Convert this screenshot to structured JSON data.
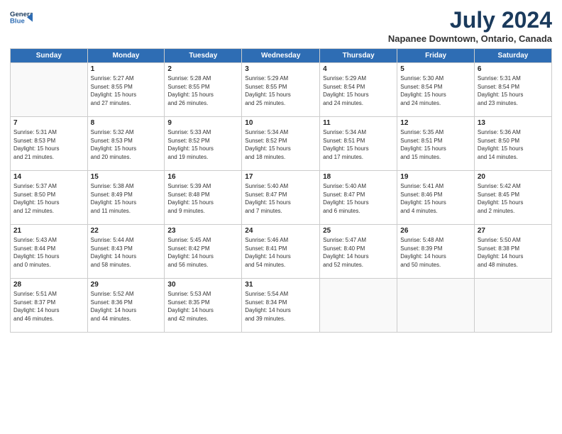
{
  "logo": {
    "line1": "General",
    "line2": "Blue"
  },
  "title": "July 2024",
  "subtitle": "Napanee Downtown, Ontario, Canada",
  "days_header": [
    "Sunday",
    "Monday",
    "Tuesday",
    "Wednesday",
    "Thursday",
    "Friday",
    "Saturday"
  ],
  "weeks": [
    [
      {
        "day": "",
        "info": ""
      },
      {
        "day": "1",
        "info": "Sunrise: 5:27 AM\nSunset: 8:55 PM\nDaylight: 15 hours\nand 27 minutes."
      },
      {
        "day": "2",
        "info": "Sunrise: 5:28 AM\nSunset: 8:55 PM\nDaylight: 15 hours\nand 26 minutes."
      },
      {
        "day": "3",
        "info": "Sunrise: 5:29 AM\nSunset: 8:55 PM\nDaylight: 15 hours\nand 25 minutes."
      },
      {
        "day": "4",
        "info": "Sunrise: 5:29 AM\nSunset: 8:54 PM\nDaylight: 15 hours\nand 24 minutes."
      },
      {
        "day": "5",
        "info": "Sunrise: 5:30 AM\nSunset: 8:54 PM\nDaylight: 15 hours\nand 24 minutes."
      },
      {
        "day": "6",
        "info": "Sunrise: 5:31 AM\nSunset: 8:54 PM\nDaylight: 15 hours\nand 23 minutes."
      }
    ],
    [
      {
        "day": "7",
        "info": "Sunrise: 5:31 AM\nSunset: 8:53 PM\nDaylight: 15 hours\nand 21 minutes."
      },
      {
        "day": "8",
        "info": "Sunrise: 5:32 AM\nSunset: 8:53 PM\nDaylight: 15 hours\nand 20 minutes."
      },
      {
        "day": "9",
        "info": "Sunrise: 5:33 AM\nSunset: 8:52 PM\nDaylight: 15 hours\nand 19 minutes."
      },
      {
        "day": "10",
        "info": "Sunrise: 5:34 AM\nSunset: 8:52 PM\nDaylight: 15 hours\nand 18 minutes."
      },
      {
        "day": "11",
        "info": "Sunrise: 5:34 AM\nSunset: 8:51 PM\nDaylight: 15 hours\nand 17 minutes."
      },
      {
        "day": "12",
        "info": "Sunrise: 5:35 AM\nSunset: 8:51 PM\nDaylight: 15 hours\nand 15 minutes."
      },
      {
        "day": "13",
        "info": "Sunrise: 5:36 AM\nSunset: 8:50 PM\nDaylight: 15 hours\nand 14 minutes."
      }
    ],
    [
      {
        "day": "14",
        "info": "Sunrise: 5:37 AM\nSunset: 8:50 PM\nDaylight: 15 hours\nand 12 minutes."
      },
      {
        "day": "15",
        "info": "Sunrise: 5:38 AM\nSunset: 8:49 PM\nDaylight: 15 hours\nand 11 minutes."
      },
      {
        "day": "16",
        "info": "Sunrise: 5:39 AM\nSunset: 8:48 PM\nDaylight: 15 hours\nand 9 minutes."
      },
      {
        "day": "17",
        "info": "Sunrise: 5:40 AM\nSunset: 8:47 PM\nDaylight: 15 hours\nand 7 minutes."
      },
      {
        "day": "18",
        "info": "Sunrise: 5:40 AM\nSunset: 8:47 PM\nDaylight: 15 hours\nand 6 minutes."
      },
      {
        "day": "19",
        "info": "Sunrise: 5:41 AM\nSunset: 8:46 PM\nDaylight: 15 hours\nand 4 minutes."
      },
      {
        "day": "20",
        "info": "Sunrise: 5:42 AM\nSunset: 8:45 PM\nDaylight: 15 hours\nand 2 minutes."
      }
    ],
    [
      {
        "day": "21",
        "info": "Sunrise: 5:43 AM\nSunset: 8:44 PM\nDaylight: 15 hours\nand 0 minutes."
      },
      {
        "day": "22",
        "info": "Sunrise: 5:44 AM\nSunset: 8:43 PM\nDaylight: 14 hours\nand 58 minutes."
      },
      {
        "day": "23",
        "info": "Sunrise: 5:45 AM\nSunset: 8:42 PM\nDaylight: 14 hours\nand 56 minutes."
      },
      {
        "day": "24",
        "info": "Sunrise: 5:46 AM\nSunset: 8:41 PM\nDaylight: 14 hours\nand 54 minutes."
      },
      {
        "day": "25",
        "info": "Sunrise: 5:47 AM\nSunset: 8:40 PM\nDaylight: 14 hours\nand 52 minutes."
      },
      {
        "day": "26",
        "info": "Sunrise: 5:48 AM\nSunset: 8:39 PM\nDaylight: 14 hours\nand 50 minutes."
      },
      {
        "day": "27",
        "info": "Sunrise: 5:50 AM\nSunset: 8:38 PM\nDaylight: 14 hours\nand 48 minutes."
      }
    ],
    [
      {
        "day": "28",
        "info": "Sunrise: 5:51 AM\nSunset: 8:37 PM\nDaylight: 14 hours\nand 46 minutes."
      },
      {
        "day": "29",
        "info": "Sunrise: 5:52 AM\nSunset: 8:36 PM\nDaylight: 14 hours\nand 44 minutes."
      },
      {
        "day": "30",
        "info": "Sunrise: 5:53 AM\nSunset: 8:35 PM\nDaylight: 14 hours\nand 42 minutes."
      },
      {
        "day": "31",
        "info": "Sunrise: 5:54 AM\nSunset: 8:34 PM\nDaylight: 14 hours\nand 39 minutes."
      },
      {
        "day": "",
        "info": ""
      },
      {
        "day": "",
        "info": ""
      },
      {
        "day": "",
        "info": ""
      }
    ]
  ]
}
